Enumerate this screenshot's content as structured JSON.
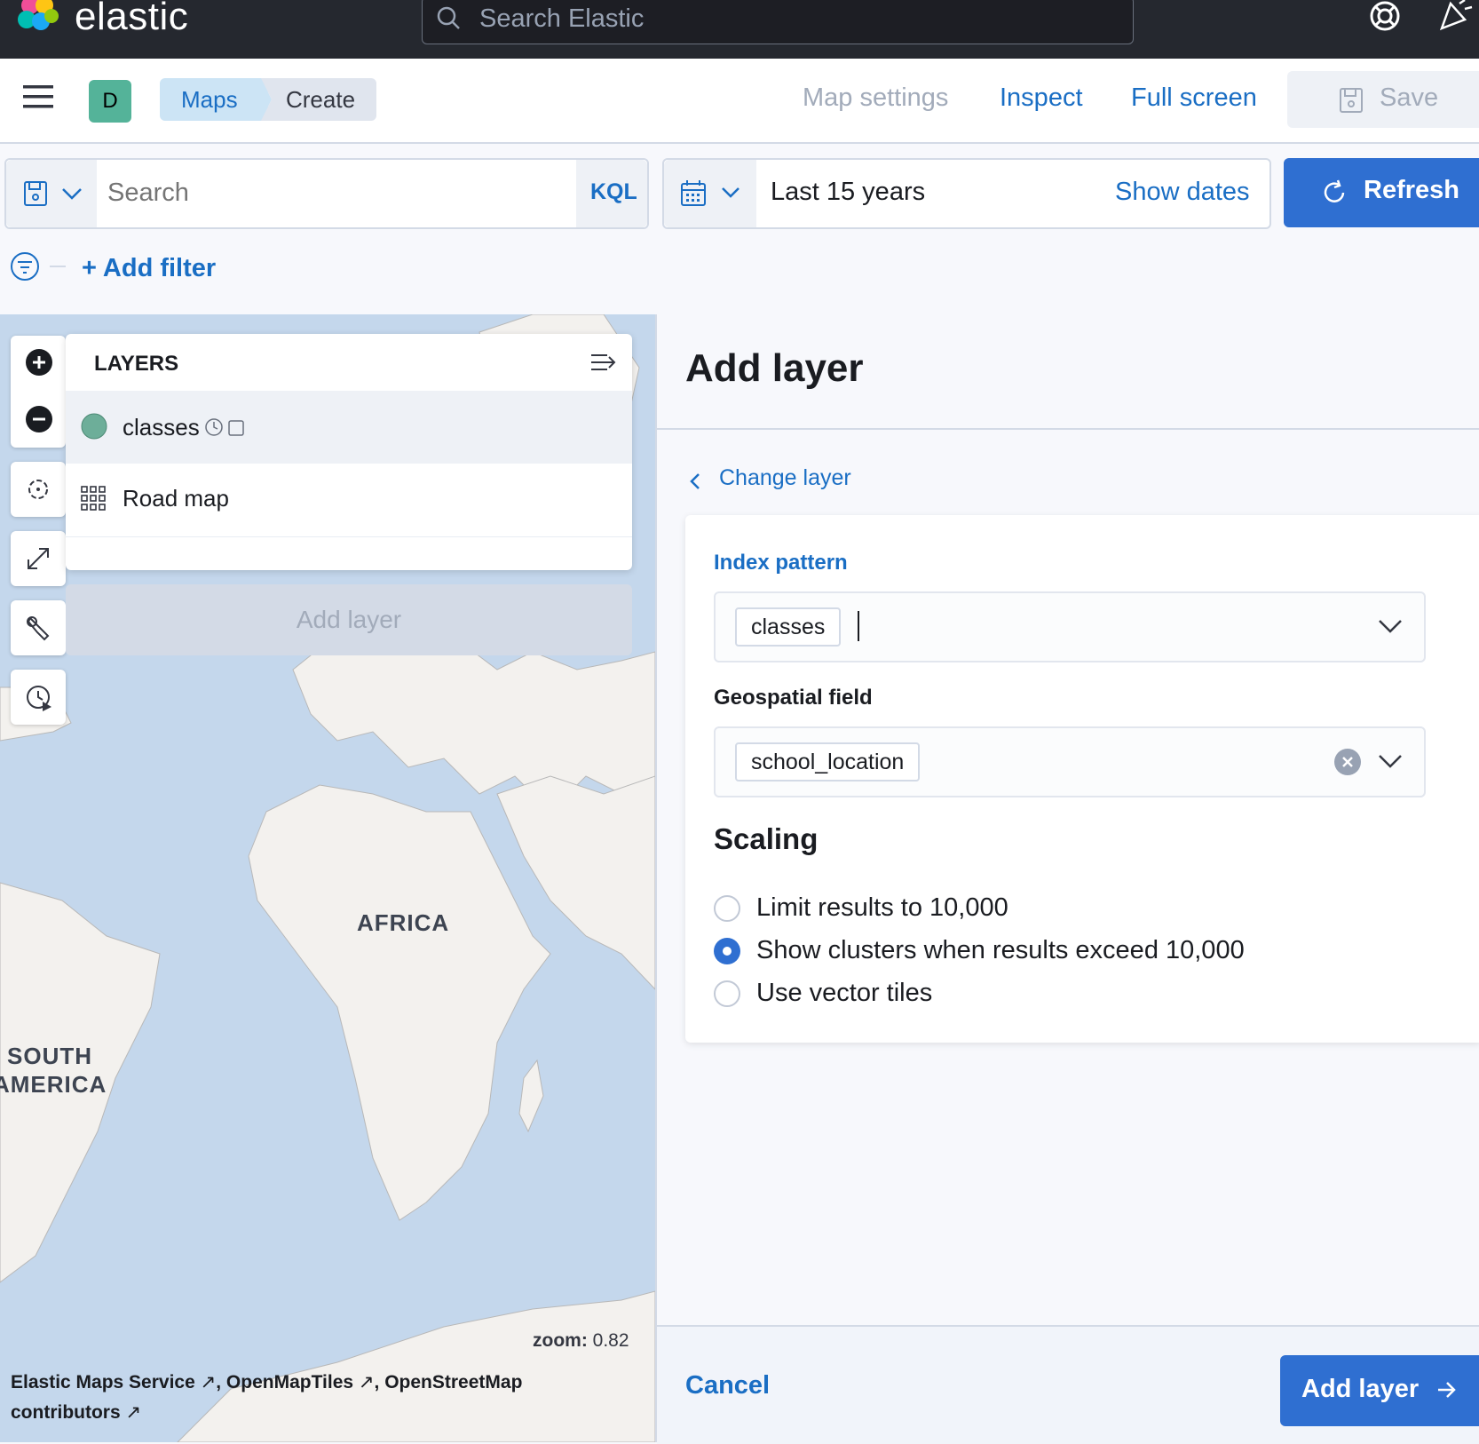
{
  "header": {
    "brand": "elastic",
    "search_placeholder": "Search Elastic"
  },
  "nav": {
    "space_initial": "D",
    "breadcrumbs": [
      "Maps",
      "Create"
    ],
    "map_settings": "Map settings",
    "inspect": "Inspect",
    "full_screen": "Full screen",
    "save": "Save"
  },
  "query": {
    "search_placeholder": "Search",
    "language": "KQL",
    "time_range": "Last 15 years",
    "show_dates": "Show dates",
    "refresh": "Refresh",
    "add_filter": "+ Add filter"
  },
  "layers": {
    "title": "LAYERS",
    "items": [
      {
        "label": "classes",
        "swatch": "#6dae99"
      },
      {
        "label": "Road map"
      }
    ],
    "add_layer": "Add layer"
  },
  "map": {
    "labels": [
      "AFRICA",
      "SOUTH",
      "AMERICA"
    ],
    "zoom_label": "zoom:",
    "zoom_value": "0.82",
    "attribution": [
      "Elastic Maps Service",
      "OpenMapTiles",
      "OpenStreetMap",
      "contributors"
    ]
  },
  "panel": {
    "title": "Add layer",
    "change_layer": "Change layer",
    "index_pattern_label": "Index pattern",
    "index_pattern_value": "classes",
    "geo_field_label": "Geospatial field",
    "geo_field_value": "school_location",
    "scaling_title": "Scaling",
    "scaling_options": [
      "Limit results to 10,000",
      "Show clusters when results exceed 10,000",
      "Use vector tiles"
    ],
    "scaling_selected": 1,
    "cancel": "Cancel",
    "add_layer": "Add layer"
  },
  "colors": {
    "primary": "#2f6fd1",
    "link": "#1a6ec4",
    "header_dark": "#25282f",
    "ocean": "#c4d7ec",
    "land": "#f3f1ee"
  }
}
